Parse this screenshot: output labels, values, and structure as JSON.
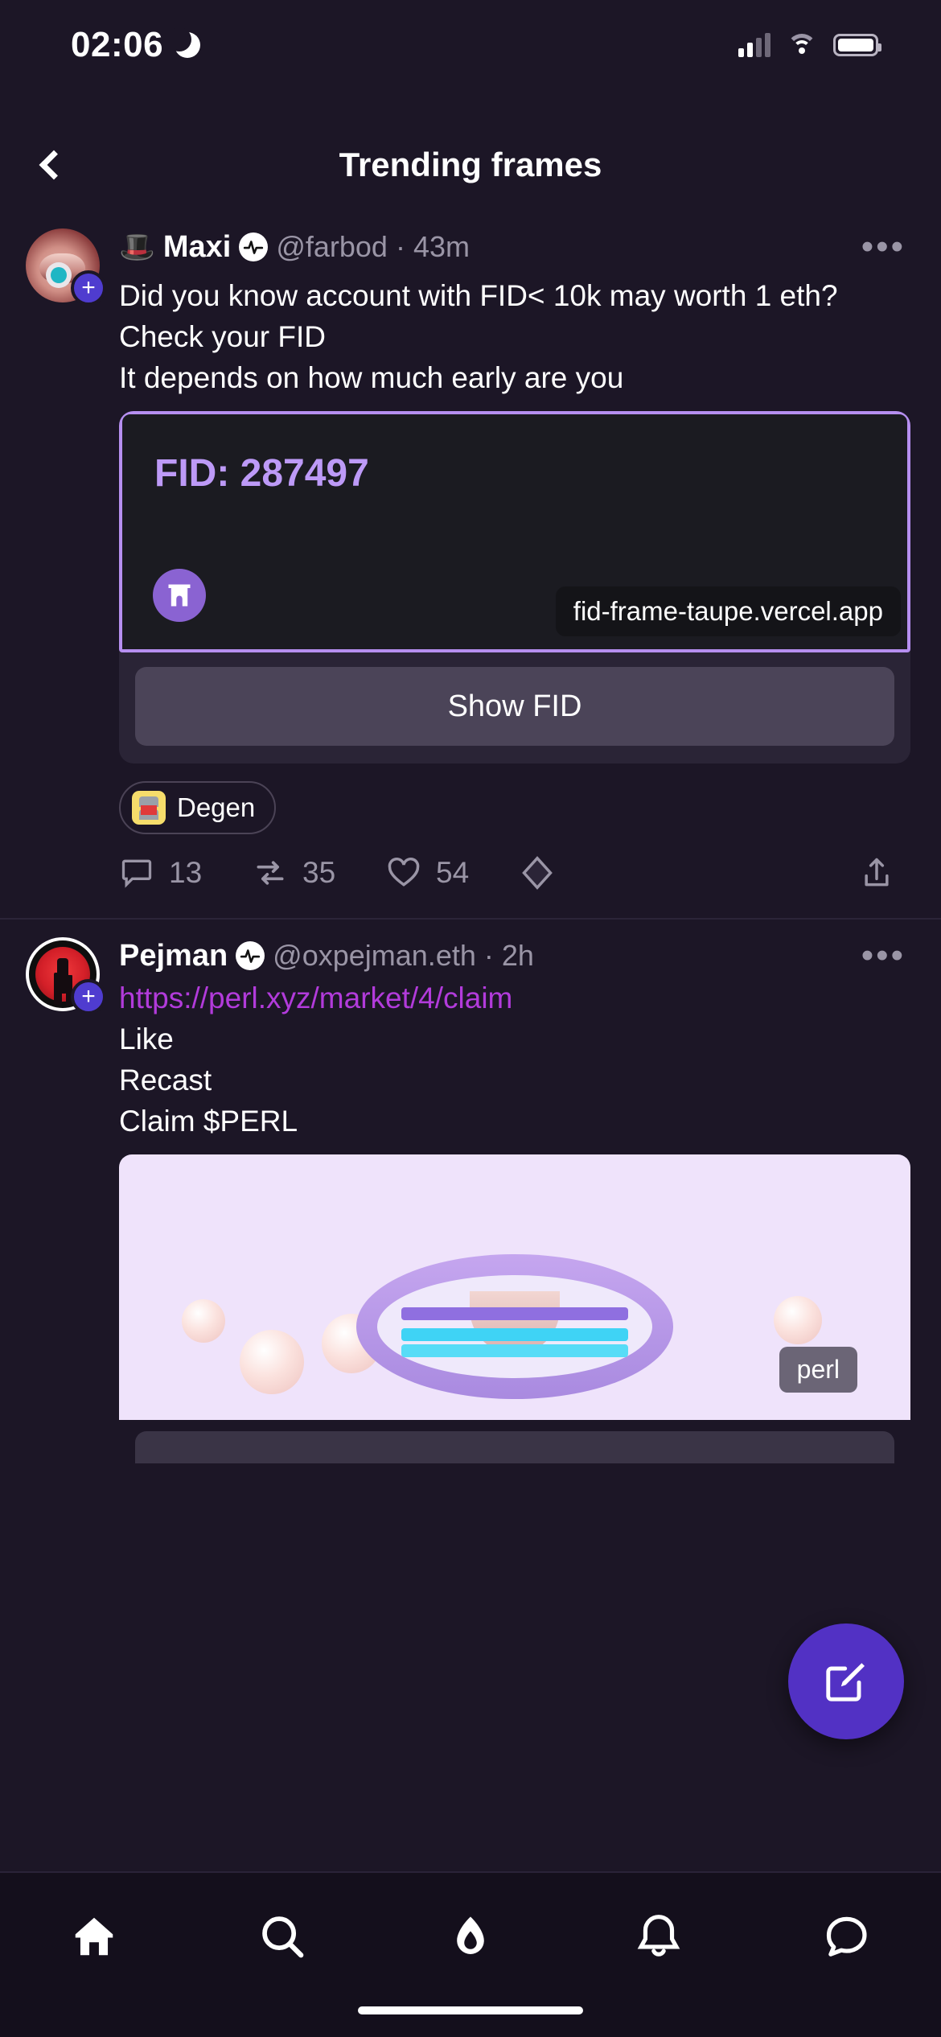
{
  "status_bar": {
    "time": "02:06",
    "dnd_icon": "moon-icon",
    "signal_icon": "cellular-signal-icon",
    "wifi_icon": "wifi-icon",
    "battery_icon": "battery-icon"
  },
  "header": {
    "back_icon": "chevron-left-icon",
    "title": "Trending frames"
  },
  "posts": [
    {
      "display_name": "Maxi",
      "name_emoji": "🎩",
      "verified_icon": "power-badge-icon",
      "handle": "@farbod",
      "separator": "·",
      "timestamp": "43m",
      "more_icon": "more-options-icon",
      "follow_icon": "add-follow-icon",
      "text": "Did you know account with FID< 10k may worth 1 eth?\nCheck your FID\nIt depends on how much early are  you",
      "frame": {
        "fid_label": "FID: 287497",
        "logo_icon": "farcaster-logo-icon",
        "url": "fid-frame-taupe.vercel.app",
        "button_label": "Show FID"
      },
      "channel": {
        "name": "Degen",
        "icon": "degen-channel-icon"
      },
      "actions": {
        "reply_icon": "comment-icon",
        "reply_count": "13",
        "recast_icon": "recast-icon",
        "recast_count": "35",
        "like_icon": "heart-icon",
        "like_count": "54",
        "tip_icon": "diamond-icon",
        "share_icon": "share-icon"
      }
    },
    {
      "display_name": "Pejman",
      "verified_icon": "power-badge-icon",
      "handle": "@oxpejman.eth",
      "separator": "·",
      "timestamp": "2h",
      "more_icon": "more-options-icon",
      "follow_icon": "add-follow-icon",
      "link": "https://perl.xyz/market/4/claim",
      "text": " Like\nRecast\nClaim $PERL",
      "frame": {
        "url_chip": "perl",
        "image_alt": "pixel-art-oyster-pearl"
      }
    }
  ],
  "compose": {
    "icon": "compose-icon"
  },
  "tabbar": {
    "items": [
      {
        "icon": "home-icon",
        "label": "Home"
      },
      {
        "icon": "search-icon",
        "label": "Search"
      },
      {
        "icon": "flame-icon",
        "label": "Trending"
      },
      {
        "icon": "bell-icon",
        "label": "Notifications"
      },
      {
        "icon": "chat-icon",
        "label": "Messages"
      }
    ]
  },
  "colors": {
    "background": "#1c1626",
    "accent_purple": "#8a63d2",
    "frame_border": "#b68ff0",
    "fid_text": "#bd9af7",
    "link": "#b23bdb",
    "muted_text": "#9a95a6"
  }
}
